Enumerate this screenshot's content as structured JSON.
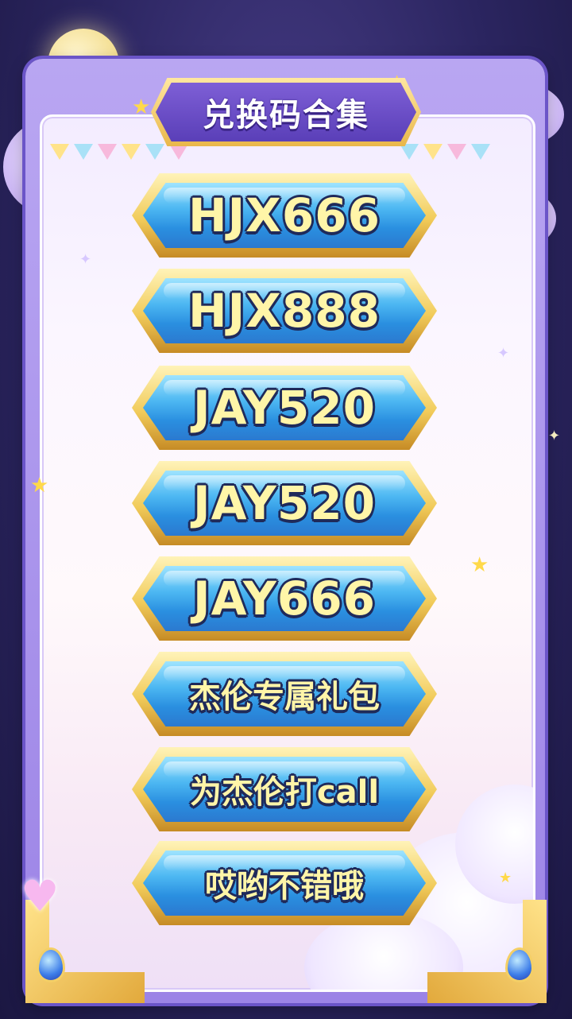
{
  "title": "兑换码合集",
  "codes": [
    {
      "label": "HJX666",
      "style": "latin"
    },
    {
      "label": "HJX888",
      "style": "latin"
    },
    {
      "label": "JAY520",
      "style": "latin"
    },
    {
      "label": "JAY520",
      "style": "latin"
    },
    {
      "label": "JAY666",
      "style": "latin"
    },
    {
      "label": "杰伦专属礼包",
      "style": "cjk"
    },
    {
      "label": "为杰伦打call",
      "style": "cjk"
    },
    {
      "label": "哎哟不错哦",
      "style": "cjk"
    }
  ],
  "colors": {
    "background": "#2b2560",
    "frame": "#9c84e6",
    "button_fill": "#2a8fe0",
    "button_border": "#f1cb5a",
    "button_text": "#fff5a8",
    "title_banner": "#5a3fb8"
  },
  "icons": [
    "moon-icon",
    "star-icon",
    "heart-icon",
    "gem-icon",
    "cloud-icon"
  ]
}
